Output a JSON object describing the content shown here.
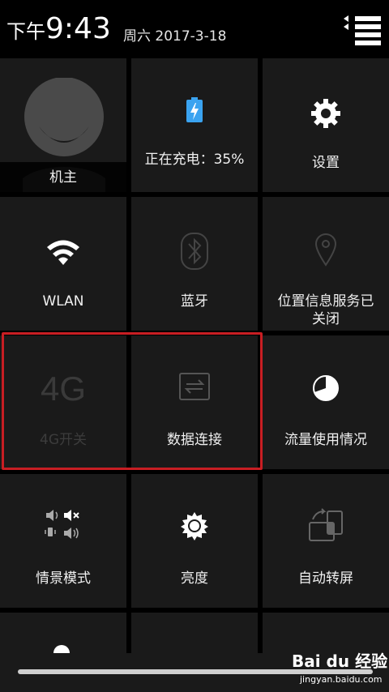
{
  "status_bar": {
    "time_prefix": "下午",
    "time": "9:43",
    "date": "周六 2017-3-18"
  },
  "tiles": [
    {
      "id": "owner",
      "label": "机主",
      "icon": "avatar-icon",
      "enabled": true
    },
    {
      "id": "battery",
      "label": "正在充电：35%",
      "icon": "battery-charging-icon",
      "enabled": true
    },
    {
      "id": "settings",
      "label": "设置",
      "icon": "gear-icon",
      "enabled": true
    },
    {
      "id": "wlan",
      "label": "WLAN",
      "icon": "wifi-icon",
      "enabled": true
    },
    {
      "id": "bluetooth",
      "label": "蓝牙",
      "icon": "bluetooth-icon",
      "enabled": false
    },
    {
      "id": "location",
      "label_line1": "位置信息服务已",
      "label_line2": "关闭",
      "icon": "location-pin-icon",
      "enabled": false
    },
    {
      "id": "4g",
      "label": "4G开关",
      "icon_text": "4G",
      "icon": "4g-icon",
      "enabled": false
    },
    {
      "id": "data",
      "label": "数据连接",
      "icon": "data-connection-icon",
      "enabled": false
    },
    {
      "id": "traffic",
      "label": "流量使用情况",
      "icon": "pie-clock-icon",
      "enabled": true
    },
    {
      "id": "profile",
      "label": "情景模式",
      "icon": "sound-profile-icon",
      "enabled": true
    },
    {
      "id": "brightness",
      "label": "亮度",
      "icon": "brightness-icon",
      "enabled": true
    },
    {
      "id": "rotate",
      "label": "自动转屏",
      "icon": "auto-rotate-icon",
      "enabled": true
    }
  ],
  "watermark": {
    "brand": "Bai du 经验",
    "url": "jingyan.baidu.com"
  },
  "colors": {
    "tile_bg": "#1a1a1a",
    "highlight": "#c81e23",
    "dim_icon": "#3c3c3c"
  }
}
